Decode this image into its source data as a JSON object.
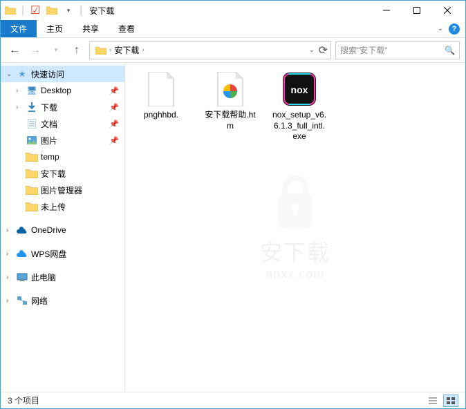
{
  "window": {
    "title": "安下载"
  },
  "ribbon": {
    "tabs": [
      "文件",
      "主页",
      "共享",
      "查看"
    ]
  },
  "breadcrumb": {
    "current": "安下载"
  },
  "search": {
    "placeholder": "搜索\"安下载\""
  },
  "sidebar": {
    "quick_access": "快速访问",
    "items": [
      {
        "label": "Desktop",
        "icon": "desktop",
        "pinned": true
      },
      {
        "label": "下载",
        "icon": "downloads",
        "pinned": true
      },
      {
        "label": "文档",
        "icon": "documents",
        "pinned": true
      },
      {
        "label": "图片",
        "icon": "pictures",
        "pinned": true
      },
      {
        "label": "temp",
        "icon": "folder",
        "pinned": false
      },
      {
        "label": "安下载",
        "icon": "folder",
        "pinned": false
      },
      {
        "label": "图片管理器",
        "icon": "folder",
        "pinned": false
      },
      {
        "label": "未上传",
        "icon": "folder",
        "pinned": false
      }
    ],
    "onedrive": "OneDrive",
    "wps": "WPS网盘",
    "this_pc": "此电脑",
    "network": "网络"
  },
  "files": [
    {
      "name": "pnghhbd.",
      "type": "blank"
    },
    {
      "name": "安下载帮助.htm",
      "type": "htm"
    },
    {
      "name": "nox_setup_v6.6.1.3_full_intl.exe",
      "type": "nox"
    }
  ],
  "statusbar": {
    "count": "3 个项目"
  },
  "watermark": {
    "main": "安下载",
    "sub": "anxz.com"
  }
}
